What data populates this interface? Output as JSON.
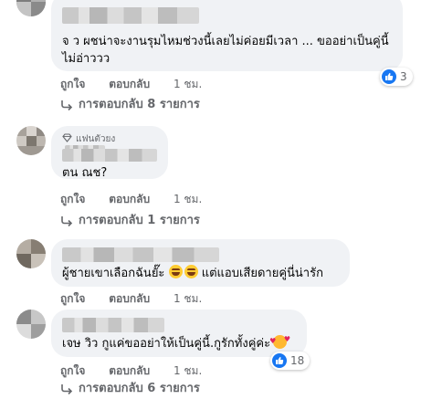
{
  "comments": [
    {
      "text": "จ ว ผชน่าจะงานรุมไหมช่วงนี้เลยไม่ค่อยมีเวลา ... ขออย่าเป็นคู่นี้ไม่อ่าววว",
      "text_line1": "จ ว ผชน่าจะงานรุมไหมช่วงนี้เลยไม่ค่อยมีเวลา ... ขออย่าเป็นคู่นี้",
      "text_line2": "ไม่อ่าววว",
      "reaction": {
        "icon": "like-icon",
        "count": "3"
      },
      "actions": {
        "like": "ถูกใจ",
        "reply": "ตอบกลับ",
        "time": "1 ชม."
      },
      "replies": "การตอบกลับ 8 รายการ"
    },
    {
      "badge": "แฟนตัวยง",
      "text": "ตน ณช?",
      "actions": {
        "like": "ถูกใจ",
        "reply": "ตอบกลับ",
        "time": "1 ชม."
      },
      "replies": "การตอบกลับ 1 รายการ"
    },
    {
      "text_before": "ผู้ชายเขาเลือกฉันยั๊ะ",
      "emojis": [
        "rofl-emoji",
        "rofl-emoji"
      ],
      "text_after": "แต่แอบเสียดายคู่นี่น่ารัก",
      "actions": {
        "like": "ถูกใจ",
        "reply": "ตอบกลับ",
        "time": "1 ชม."
      }
    },
    {
      "text_before": "เจษ วิว กูแค่ขออย่าให้เป็นคู่นี้.กูรักทั้งคู่ค่ะ",
      "emojis": [
        "smiling-face-with-hearts-emoji"
      ],
      "reaction": {
        "icon": "like-icon",
        "count": "18"
      },
      "actions": {
        "like": "ถูกใจ",
        "reply": "ตอบกลับ",
        "time": "1 ชม."
      },
      "replies": "การตอบกลับ 6 รายการ"
    }
  ],
  "colors": {
    "bubble_bg": "#f0f2f5",
    "meta_text": "#65676b",
    "like_blue": "#1877f2"
  }
}
